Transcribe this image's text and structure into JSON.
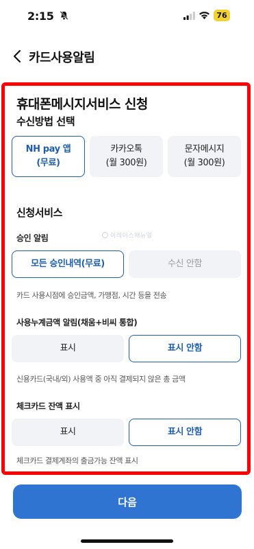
{
  "status_bar": {
    "time": "2:15",
    "battery": "76",
    "icons": [
      "bell-slash-icon",
      "signal-icon",
      "wifi-icon",
      "battery-icon"
    ]
  },
  "nav": {
    "back_icon": "chevron-left-icon",
    "title": "카드사용알림"
  },
  "panel": {
    "title": "휴대폰메시지서비스 신청",
    "method_heading": "수신방법 선택",
    "methods": [
      {
        "line1": "NH pay 앱",
        "line2": "(무료)",
        "selected": true
      },
      {
        "line1": "카카오톡",
        "line2": "(월 300원)",
        "selected": false
      },
      {
        "line1": "문자메시지",
        "line2": "(월 300원)",
        "selected": false
      }
    ],
    "service_heading": "신청서비스",
    "approval": {
      "label": "승인 알림",
      "options": [
        {
          "text": "모든 승인내역(무료)",
          "selected": true
        },
        {
          "text": "수신 안함",
          "selected": false
        }
      ],
      "description": "카드 사용시점에 승인금액, 가맹점, 시간 등을 전송"
    },
    "cumulative": {
      "label": "사용누계금액 알림(채움+비씨 통합)",
      "options": [
        {
          "text": "표시",
          "selected": false
        },
        {
          "text": "표시 안함",
          "selected": true
        }
      ],
      "description": "신용카드(국내/외) 사용액 중 아직 결제되지 않은 총 금액"
    },
    "balance": {
      "label": "체크카드 잔액 표시",
      "options": [
        {
          "text": "표시",
          "selected": false
        },
        {
          "text": "표시 안함",
          "selected": true
        }
      ],
      "description": "체크카드 결제계좌의 출금가능 잔액 표시"
    },
    "watermark": "이레이스매뉴얼"
  },
  "footer": {
    "next_label": "다음"
  },
  "colors": {
    "accent": "#1f5da8",
    "button": "#2f74d0",
    "highlight_border": "#ff0000",
    "unselected_bg": "#f2f3f6"
  }
}
